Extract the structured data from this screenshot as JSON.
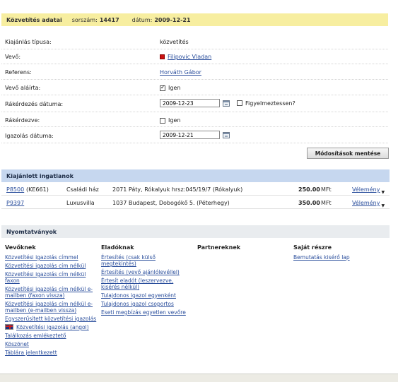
{
  "header": {
    "title": "Közvetítés adatai",
    "serial_label": "sorszám:",
    "serial_value": "14417",
    "date_label": "dátum:",
    "date_value": "2009-12-21"
  },
  "form": {
    "offer_type_label": "Kiajánlás típusa:",
    "offer_type_value": "közvetítés",
    "buyer_label": "Vevő:",
    "buyer_value": "Filipovic Vladan",
    "referent_label": "Referens:",
    "referent_value": "Horváth Gábor",
    "buyer_signed_label": "Vevő aláírta:",
    "buyer_signed_value": "Igen",
    "followup_date_label": "Rákérdezés dátuma:",
    "followup_date_value": "2009-12-23",
    "warn_label": "Figyelmeztessen?",
    "asked_label": "Rákérdezve:",
    "asked_value": "Igen",
    "cert_date_label": "Igazolás dátuma:",
    "cert_date_value": "2009-12-21",
    "save_label": "Módosítások mentése"
  },
  "properties": {
    "title": "Kiajánlott ingatlanok",
    "rows": [
      {
        "id": "P8500",
        "code": "(KE661)",
        "type": "Családi ház",
        "address": "2071 Páty, Rókalyuk hrsz:045/19/7 (Rókalyuk)",
        "price": "250.00",
        "currency": "MFt",
        "action": "Vélemény"
      },
      {
        "id": "P9397",
        "code": "",
        "type": "Luxusvilla",
        "address": "1037 Budapest, Dobogókő 5. (Péterhegy)",
        "price": "350.00",
        "currency": "MFt",
        "action": "Vélemény"
      }
    ]
  },
  "prints": {
    "title": "Nyomtatványok",
    "col_buyers": "Vevőknek",
    "col_sellers": "Eladóknak",
    "col_partners": "Partnereknek",
    "col_own": "Saját részre",
    "buyers": [
      "Közvetítési igazolás címmel",
      "Közvetítési igazolás cím nélkül",
      "Közvetítési igazolás cím nélkül faxon",
      "Közvetítési igazolás cím nélkül e-mailben (faxon vissza)",
      "Közvetítési igazolás cím nélkül e-mailben (e-mailben vissza)",
      "Egyszerűsített közvetítési igazolás",
      "Közvetítési igazolás (angol)",
      "Találkozás emlékeztető",
      "Köszönet",
      "Táblára jelentkezett"
    ],
    "sellers": [
      "Értesítés (csak külső megtekintés)",
      "Értesítés (vevő ajánlólevéllel)",
      "Értesít eladót (leszervezve, kisérés nélkül)",
      "Tulajdonos igazol egyenként",
      "Tulajdonos igazol csoportos",
      "Eseti megbízás egyetlen vevőre"
    ],
    "own": [
      "Bemutatás kisérő lap"
    ]
  }
}
